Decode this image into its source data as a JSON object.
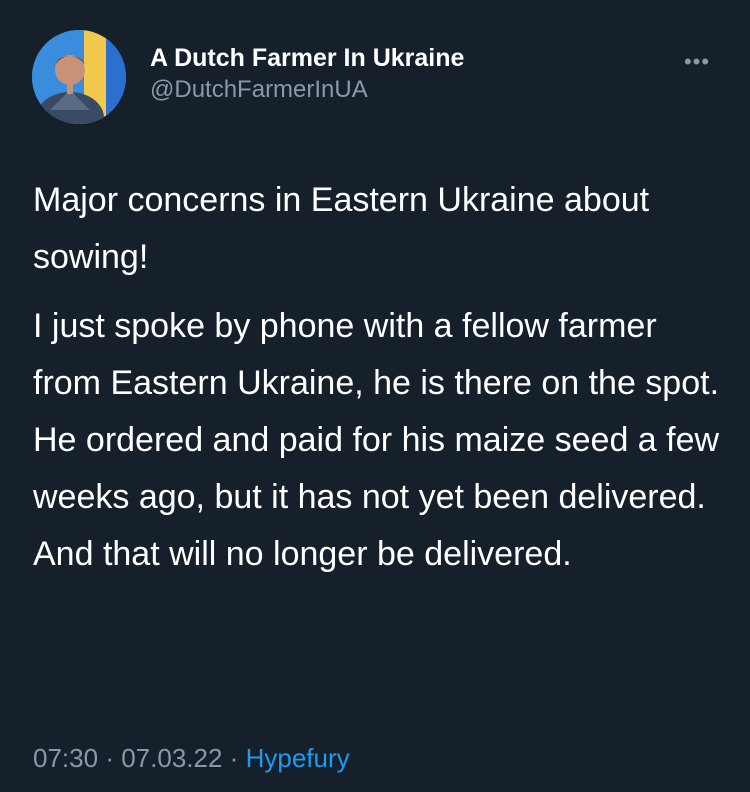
{
  "tweet": {
    "author": {
      "display_name": "A Dutch Farmer In Ukraine",
      "handle": "@DutchFarmerInUA",
      "avatar_icon": "profile-photo"
    },
    "more_icon": "more-options-icon",
    "paragraphs": [
      "Major concerns in Eastern Ukraine about sowing!",
      "I just spoke by phone with a fellow farmer from Eastern Ukraine, he is there on the spot."
    ],
    "line_3": "He ordered and paid for his maize seed a few weeks ago, but it has not yet been delivered. And that will no longer be delivered.",
    "time": "07:30",
    "date": "07.03.22",
    "separator": "·",
    "source": "Hypefury"
  },
  "colors": {
    "background": "#15202b",
    "text": "#ffffff",
    "muted": "#8b98a5",
    "link": "#1d9bf0"
  }
}
